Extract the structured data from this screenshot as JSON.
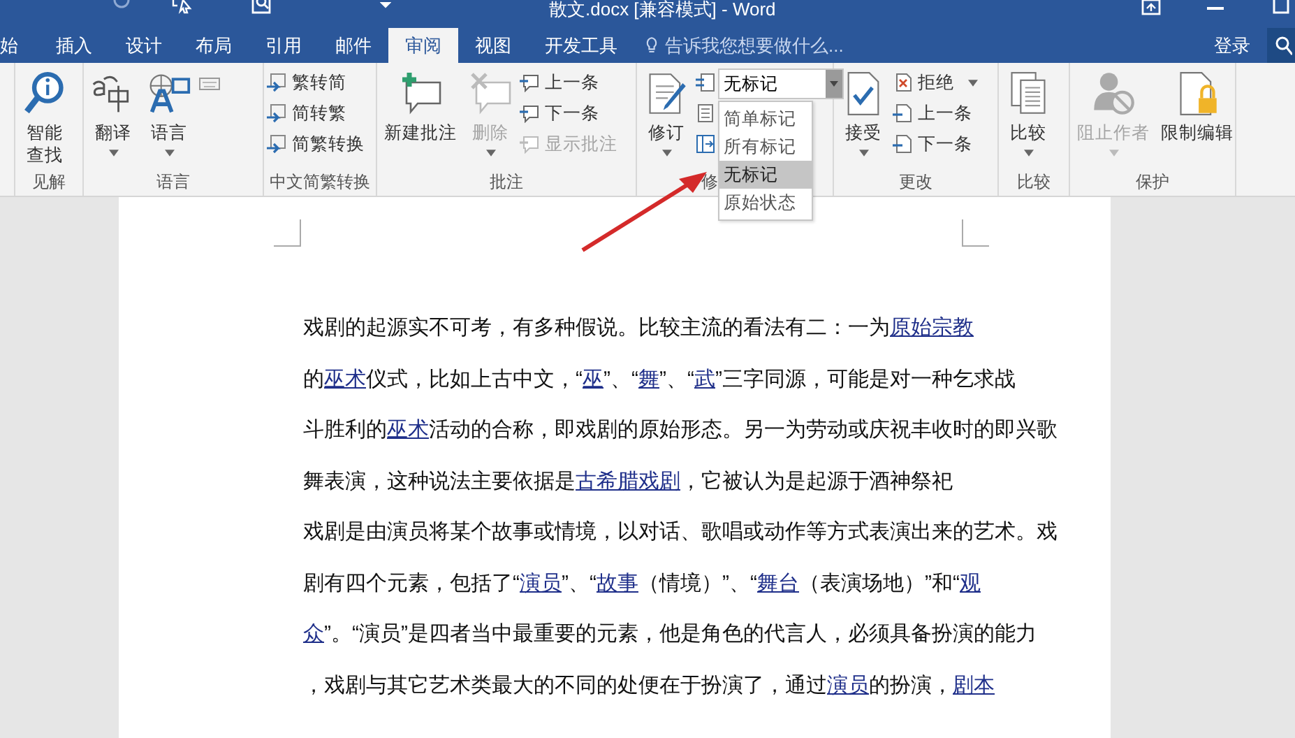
{
  "window": {
    "title": "散文.docx [兼容模式] - Word"
  },
  "tabs": [
    {
      "label": "始",
      "selected": false
    },
    {
      "label": "插入",
      "selected": false
    },
    {
      "label": "设计",
      "selected": false
    },
    {
      "label": "布局",
      "selected": false
    },
    {
      "label": "引用",
      "selected": false
    },
    {
      "label": "邮件",
      "selected": false
    },
    {
      "label": "审阅",
      "selected": true
    },
    {
      "label": "视图",
      "selected": false
    },
    {
      "label": "开发工具",
      "selected": false
    }
  ],
  "tell_me": {
    "placeholder": "告诉我您想要做什么..."
  },
  "sign_in": "登录",
  "ribbon": {
    "groups": [
      {
        "label": "见解",
        "items": [
          {
            "label": "智能查找",
            "disabled": false
          }
        ]
      },
      {
        "label": "语言",
        "items": [
          {
            "label": "翻译",
            "disabled": false
          },
          {
            "label": "语言",
            "disabled": false
          }
        ]
      },
      {
        "label": "中文简繁转换",
        "items": [
          {
            "label": "繁转简",
            "disabled": false
          },
          {
            "label": "简转繁",
            "disabled": false
          },
          {
            "label": "简繁转换",
            "disabled": false
          }
        ]
      },
      {
        "label": "批注",
        "items": [
          {
            "label": "新建批注",
            "disabled": false
          },
          {
            "label": "删除",
            "disabled": true
          },
          {
            "label": "上一条",
            "disabled": false
          },
          {
            "label": "下一条",
            "disabled": false
          },
          {
            "label": "显示批注",
            "disabled": true
          }
        ]
      },
      {
        "label": "修",
        "items": [
          {
            "label": "修订",
            "disabled": false
          }
        ],
        "markup_select": {
          "value": "无标记",
          "expanded": true,
          "options": [
            {
              "label": "简单标记",
              "selected": false
            },
            {
              "label": "所有标记",
              "selected": false
            },
            {
              "label": "无标记",
              "selected": true
            },
            {
              "label": "原始状态",
              "selected": false
            }
          ]
        }
      },
      {
        "label": "更改",
        "items": [
          {
            "label": "接受",
            "disabled": false
          },
          {
            "label": "拒绝",
            "disabled": false
          },
          {
            "label": "上一条",
            "disabled": false
          },
          {
            "label": "下一条",
            "disabled": false
          }
        ]
      },
      {
        "label": "比较",
        "items": [
          {
            "label": "比较",
            "disabled": false
          }
        ]
      },
      {
        "label": "保护",
        "items": [
          {
            "label": "阻止作者",
            "disabled": true
          },
          {
            "label": "限制编辑",
            "disabled": false
          }
        ]
      }
    ]
  },
  "document": {
    "lines": [
      [
        {
          "text": "戏剧的起源实不可考，有多种假说。比较主流的看法有二：一为",
          "link": false
        },
        {
          "text": "原始宗教",
          "link": true
        }
      ],
      [
        {
          "text": "的",
          "link": false
        },
        {
          "text": "巫术",
          "link": true
        },
        {
          "text": "仪式，比如上古中文，“",
          "link": false
        },
        {
          "text": "巫",
          "link": true
        },
        {
          "text": "”、“",
          "link": false
        },
        {
          "text": "舞",
          "link": true
        },
        {
          "text": "”、“",
          "link": false
        },
        {
          "text": "武",
          "link": true
        },
        {
          "text": "”三字同源，可能是对一种乞求战",
          "link": false
        }
      ],
      [
        {
          "text": "斗胜利的",
          "link": false
        },
        {
          "text": "巫术",
          "link": true
        },
        {
          "text": "活动的合称，即戏剧的原始形态。另一为劳动或庆祝丰收时的即兴歌",
          "link": false
        }
      ],
      [
        {
          "text": "舞表演，这种说法主要依据是",
          "link": false
        },
        {
          "text": "古希腊戏剧",
          "link": true
        },
        {
          "text": "，它被认为是起源于酒神祭祀",
          "link": false
        }
      ],
      [
        {
          "text": "戏剧是由演员将某个故事或情境，以对话、歌唱或动作等方式表演出来的艺术。戏",
          "link": false
        }
      ],
      [
        {
          "text": "剧有四个元素，包括了“",
          "link": false
        },
        {
          "text": "演员",
          "link": true
        },
        {
          "text": "”、“",
          "link": false
        },
        {
          "text": "故事",
          "link": true
        },
        {
          "text": "（情境）”、“",
          "link": false
        },
        {
          "text": "舞台",
          "link": true
        },
        {
          "text": "（表演场地）”和“",
          "link": false
        },
        {
          "text": "观",
          "link": true
        }
      ],
      [
        {
          "text": "众",
          "link": true
        },
        {
          "text": "”。“演员”是四者当中最重要的元素，他是角色的代言人，必须具备扮演的能力",
          "link": false
        }
      ],
      [
        {
          "text": "，戏剧与其它艺术类最大的不同的处便在于扮演了，通过",
          "link": false
        },
        {
          "text": "演员",
          "link": true
        },
        {
          "text": "的扮演，",
          "link": false
        },
        {
          "text": "剧本",
          "link": true
        }
      ]
    ]
  }
}
